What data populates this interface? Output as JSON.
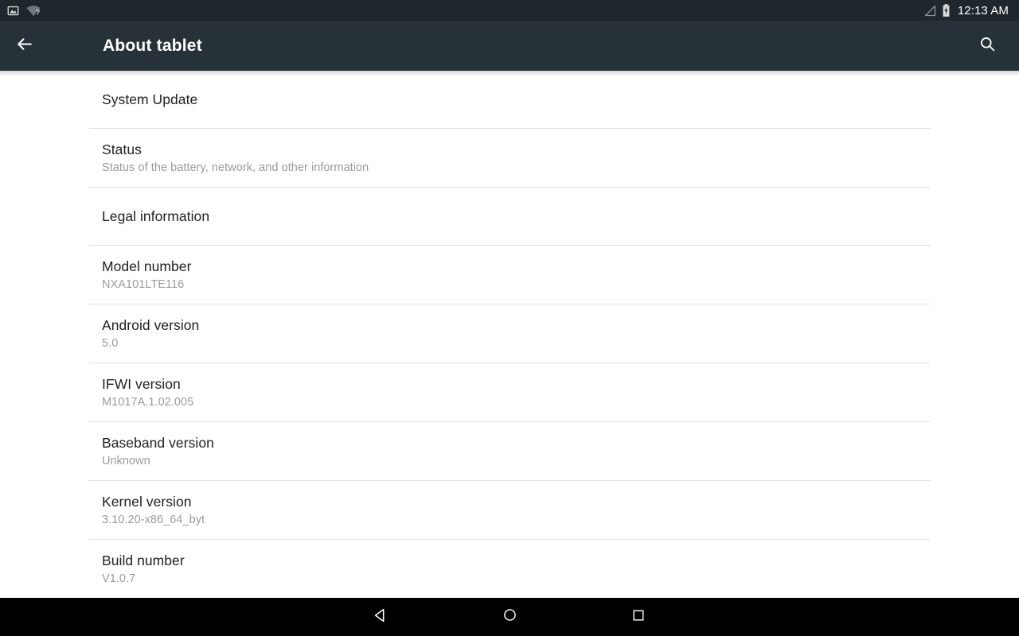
{
  "status_bar": {
    "left_icons": [
      {
        "name": "screenshot-icon"
      },
      {
        "name": "wifi-unknown-icon"
      }
    ],
    "right_icons": [
      {
        "name": "cellular-signal-icon"
      },
      {
        "name": "battery-charging-icon"
      }
    ],
    "time": "12:13 AM",
    "background_color": "#1f272c"
  },
  "action_bar": {
    "back_label": "back-arrow",
    "title": "About tablet",
    "search_label": "search",
    "background_color": "#263238",
    "text_color": "#ffffff"
  },
  "list": {
    "divider_color": "#e0e0e0",
    "title_color": "#212121",
    "summary_color": "#9b9b9b",
    "items": [
      {
        "title": "System Update",
        "summary": ""
      },
      {
        "title": "Status",
        "summary": "Status of the battery, network, and other information"
      },
      {
        "title": "Legal information",
        "summary": ""
      },
      {
        "title": "Model number",
        "summary": "NXA101LTE116"
      },
      {
        "title": "Android version",
        "summary": "5.0"
      },
      {
        "title": "IFWI version",
        "summary": "M1017A.1.02.005"
      },
      {
        "title": "Baseband version",
        "summary": "Unknown"
      },
      {
        "title": "Kernel version",
        "summary": "3.10.20-x86_64_byt"
      },
      {
        "title": "Build number",
        "summary": "V1.0.7"
      }
    ]
  },
  "nav_bar": {
    "background_color": "#000000",
    "buttons": [
      {
        "name": "nav-back-icon"
      },
      {
        "name": "nav-home-icon"
      },
      {
        "name": "nav-recents-icon"
      }
    ]
  }
}
